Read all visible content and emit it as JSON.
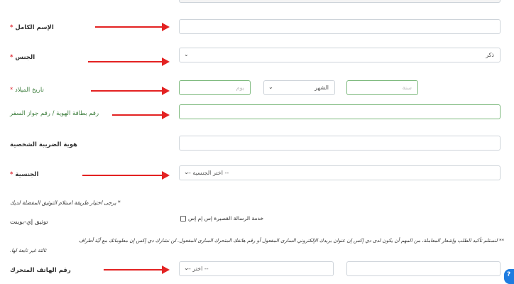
{
  "form": {
    "full_name": {
      "label": "الإسم الكامل",
      "required_mark": "*",
      "value": ""
    },
    "gender": {
      "label": "الجنس",
      "required_mark": "*",
      "selected": "ذكر"
    },
    "birth_date": {
      "label": "تاريخ الميلاد",
      "required_mark": "*",
      "day_placeholder": "يوم",
      "month_selected": "الشهر",
      "year_placeholder": "سنة"
    },
    "id_passport": {
      "label": "رقم بطاقة الهوية / رقم جواز السفر",
      "value": ""
    },
    "tax_id": {
      "label": "هوية الضريبة الشخصية",
      "value": ""
    },
    "nationality": {
      "label": "الجنسية",
      "required_mark": "*",
      "selected": "-- اختر الجنسية --"
    },
    "verification_note": "* يرجى اختيار طريقة استلام التوثيق المفضلة لديك",
    "e_verify": {
      "label": "توثيق إي-بوينت",
      "sms_option": "خدمة الرسالة القصيرة إس إم إس"
    },
    "disclaimer_line1": "** لنستلم تأكيد الطلب وإشعار المعاملة، من المهم أن يكون لدى دي إكس إن عنوان بريدك الإلكتروني السارى المفعول أو رقم هاتفك المتحرك السارى المفعول. لن نشارك دي إكس إن معلوماتك مع أيّة أطراف",
    "disclaimer_line2": "ثالثة غير تابعة لها.",
    "mobile": {
      "label": "رقم الهاتف المتحرك",
      "code_selected": "-- اختر --",
      "value": ""
    }
  },
  "icons": {
    "chevron": "chevron-down-icon",
    "arrow": "red-arrow-icon",
    "help": "help-icon"
  },
  "colors": {
    "required": "#e0313b",
    "arrow": "#e32222",
    "help": "#1e7ce0",
    "green_label": "#3c7d3c"
  }
}
